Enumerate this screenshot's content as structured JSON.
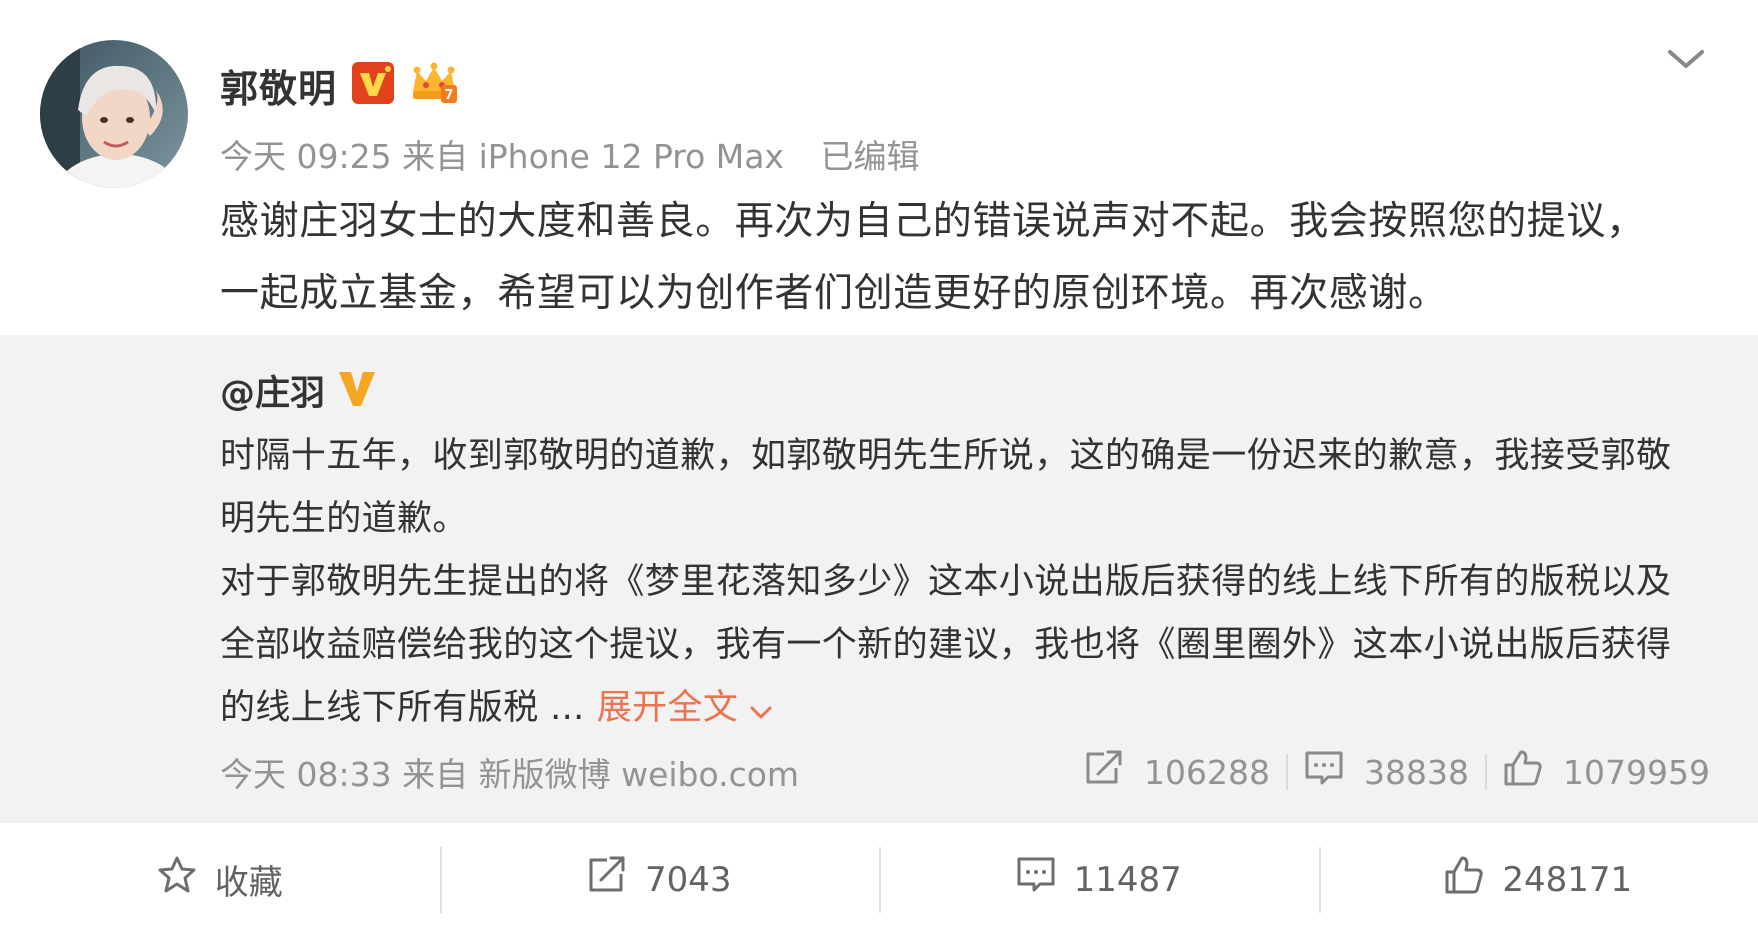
{
  "post": {
    "author": "郭敬明",
    "timestamp": "今天 09:25",
    "source": "来自 iPhone 12 Pro Max",
    "edited": "已编辑",
    "text": "感谢庄羽女士的大度和善良。再次为自己的错误说声对不起。我会按照您的提议，一起成立基金，希望可以为创作者们创造更好的原创环境。再次感谢。",
    "badges": [
      "verified-v-icon",
      "crown-member-icon"
    ]
  },
  "repost": {
    "author": "@庄羽",
    "paragraph1": "时隔十五年，收到郭敬明的道歉，如郭敬明先生所说，这的确是一份迟来的歉意，我接受郭敬明先生的道歉。",
    "paragraph2": "对于郭敬明先生提出的将《梦里花落知多少》这本小说出版后获得的线上线下所有的版税以及全部收益赔偿给我的这个提议，我有一个新的建议，我也将《圈里圈外》这本小说出版后获得的线上线下所有版税 ...",
    "expand_label": "展开全文",
    "timestamp": "今天 08:33",
    "source": "来自 新版微博 weibo.com",
    "reposts": "106288",
    "comments": "38838",
    "likes": "1079959"
  },
  "actions": {
    "favorite_label": "收藏",
    "reposts": "7043",
    "comments": "11487",
    "likes": "248171"
  },
  "colors": {
    "text": "#333333",
    "meta": "#939393",
    "link": "#eb7350",
    "quote_bg": "#f2f2f2",
    "verified_orange": "#f5a623",
    "verified_red": "#e2411b"
  }
}
